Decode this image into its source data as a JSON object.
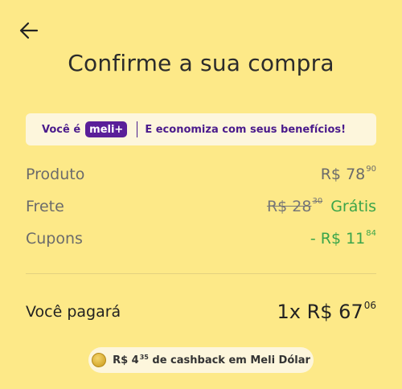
{
  "header": {
    "title": "Confirme a sua compra"
  },
  "banner": {
    "prefix": "Você é",
    "badge": "meli+",
    "text": "E economiza com seus benefícios!"
  },
  "summary": {
    "product": {
      "label": "Produto",
      "currency": "R$",
      "whole": "78",
      "cents": "90"
    },
    "shipping": {
      "label": "Frete",
      "old_whole": "R$ 28",
      "old_cents": "30",
      "value": "Grátis"
    },
    "coupons": {
      "label": "Cupons",
      "prefix": "- R$",
      "whole": "11",
      "cents": "84"
    }
  },
  "total": {
    "label": "Você pagará",
    "installments": "1x",
    "currency": "R$",
    "whole": "67",
    "cents": "06"
  },
  "cashback": {
    "currency": "R$",
    "whole": "4",
    "cents": "35",
    "text": "de cashback em Meli Dólar"
  },
  "colors": {
    "background": "#fde988",
    "accent": "#5a1f99",
    "green": "#3aa54a"
  },
  "icons": {
    "back": "arrow-left-icon",
    "coin": "coin-icon"
  }
}
